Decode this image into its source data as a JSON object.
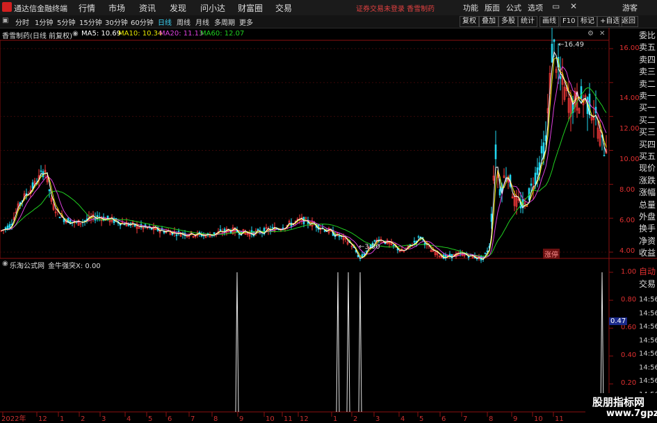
{
  "titlebar": {
    "app_name": "通达信金融终端",
    "menus": [
      "行情",
      "市场",
      "资讯",
      "发现",
      "问小达",
      "财富圈",
      "交易"
    ],
    "notice": "证券交易未登录  香雪制药",
    "right_menus": [
      "功能",
      "版面",
      "公式",
      "选项"
    ],
    "user": "游客"
  },
  "toolbar": {
    "periods": [
      "分时",
      "1分钟",
      "5分钟",
      "15分钟",
      "30分钟",
      "60分钟",
      "日线",
      "周线",
      "月线",
      "多周期",
      "更多"
    ],
    "active_period": "日线",
    "right_buttons": [
      "复权",
      "叠加",
      "多股",
      "统计",
      "画线",
      "F10",
      "标记",
      "+自选",
      "返回"
    ]
  },
  "main_chart": {
    "title": "香雪制药(日线 前复权)",
    "ma5": "MA5: 10.69",
    "ma10": "MA10: 10.34",
    "ma20": "MA20: 11.13",
    "ma60": "MA60: 12.07",
    "ma_colors": {
      "ma5": "#ffffff",
      "ma10": "#e8e800",
      "ma20": "#e040e0",
      "ma60": "#20d020"
    },
    "y_ticks": [
      "16.00",
      "14.00",
      "12.00",
      "10.00",
      "8.00",
      "6.00",
      "4.00"
    ],
    "high_label": "16.49",
    "low_label": "3.00",
    "tag": "涨停"
  },
  "sub_chart": {
    "title": "乐淘公式网",
    "indicator": "金牛强突X: 0.00",
    "y_ticks": [
      "1.00",
      "0.80",
      "0.60",
      "0.40",
      "0.20"
    ],
    "current_value": "0.47"
  },
  "x_axis": [
    "2022年",
    "12",
    "1",
    "2",
    "3",
    "4",
    "5",
    "6",
    "7",
    "8",
    "9",
    "10",
    "11",
    "12",
    "1",
    "2",
    "3",
    "4",
    "5",
    "6",
    "7",
    "8",
    "9",
    "10",
    "11"
  ],
  "right_panel": {
    "quote_labels": [
      "委比",
      "卖五",
      "卖四",
      "卖三",
      "卖二",
      "卖一",
      "买一",
      "买二",
      "买三",
      "买四",
      "买五",
      "现价",
      "涨跌",
      "涨幅",
      "总量",
      "外盘",
      "换手",
      "净资",
      "收益"
    ],
    "lower_labels": [
      "自动",
      "交易",
      "14:56",
      "14:56",
      "14:56",
      "14:56",
      "14:56",
      "14:56",
      "14:56",
      "14:56",
      "14:56"
    ]
  },
  "watermark": {
    "line1": "股朋指标网",
    "line2": "www.7gpzb.com"
  }
}
